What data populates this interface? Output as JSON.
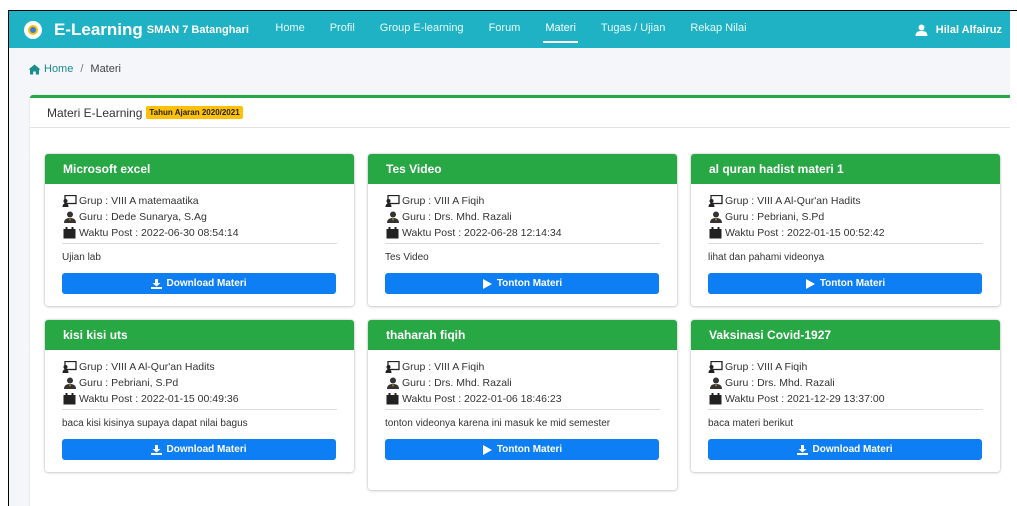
{
  "navbar": {
    "brand_title": "E-Learning",
    "brand_subtitle": "SMAN 7 Batanghari",
    "items": [
      {
        "label": "Home"
      },
      {
        "label": "Profil"
      },
      {
        "label": "Group E-learning"
      },
      {
        "label": "Forum"
      },
      {
        "label": "Materi"
      },
      {
        "label": "Tugas / Ujian"
      },
      {
        "label": "Rekap Nilai"
      }
    ],
    "active_item": "Materi",
    "user_name": "Hilal Alfairuz"
  },
  "breadcrumb": {
    "home": "Home",
    "separator": "/",
    "current": "Materi"
  },
  "panel": {
    "title": "Materi E-Learning",
    "badge": "Tahun Ajaran 2020/2021"
  },
  "cards": [
    {
      "title": "Microsoft excel",
      "grup": "Grup : VIII A matemaatika",
      "guru": "Guru : Dede Sunarya, S.Ag",
      "waktu": "Waktu Post : 2022-06-30 08:54:14",
      "desc": "Ujian lab",
      "button": "Download Materi",
      "button_icon": "download-icon"
    },
    {
      "title": "Tes Video",
      "grup": "Grup : VIII A Fiqih",
      "guru": "Guru : Drs. Mhd. Razali",
      "waktu": "Waktu Post : 2022-06-28 12:14:34",
      "desc": "Tes Video",
      "button": "Tonton Materi",
      "button_icon": "play-icon"
    },
    {
      "title": "al quran hadist materi 1",
      "grup": "Grup : VIII A Al-Qur'an Hadits",
      "guru": "Guru : Pebriani, S.Pd",
      "waktu": "Waktu Post : 2022-01-15 00:52:42",
      "desc": "lihat dan pahami videonya",
      "button": "Tonton Materi",
      "button_icon": "play-icon"
    },
    {
      "title": "kisi kisi uts",
      "grup": "Grup : VIII A Al-Qur'an Hadits",
      "guru": "Guru : Pebriani, S.Pd",
      "waktu": "Waktu Post : 2022-01-15 00:49:36",
      "desc": "baca kisi kisinya supaya dapat nilai bagus",
      "button": "Download Materi",
      "button_icon": "download-icon"
    },
    {
      "title": "thaharah fiqih",
      "grup": "Grup : VIII A Fiqih",
      "guru": "Guru : Drs. Mhd. Razali",
      "waktu": "Waktu Post : 2022-01-06 18:46:23",
      "desc": "tonton videonya karena ini masuk ke mid semester",
      "button": "Tonton Materi",
      "button_icon": "play-icon"
    },
    {
      "title": "Vaksinasi Covid-1927",
      "grup": "Grup : VIII A Fiqih",
      "guru": "Guru : Drs. Mhd. Razali",
      "waktu": "Waktu Post : 2021-12-29 13:37:00",
      "desc": "baca materi berikut",
      "button": "Download Materi",
      "button_icon": "download-icon"
    }
  ],
  "colors": {
    "navbar": "#1fb1c4",
    "card_header": "#28a745",
    "button": "#0d7ef3",
    "badge": "#ffc107"
  }
}
